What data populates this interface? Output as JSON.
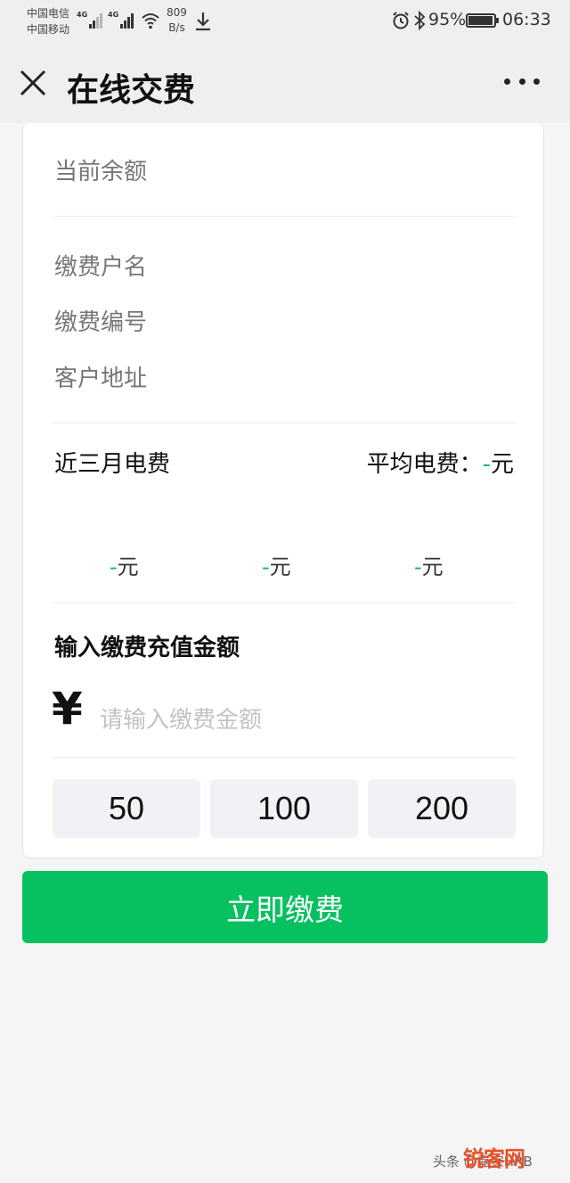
{
  "status_bar": {
    "carrier_1": "中国电信",
    "carrier_2": "中国移动",
    "network_1": "4G",
    "network_2": "4G",
    "speed_value": "809",
    "speed_unit": "B/s",
    "battery": "95%",
    "battery_level": 0.95,
    "time": "06:33",
    "icons": [
      "signal-icon",
      "wifi-icon",
      "download-icon",
      "alarm-icon",
      "bluetooth-icon",
      "battery-icon"
    ]
  },
  "nav": {
    "title": "在线交费",
    "close_icon": "close-icon",
    "more_icon": "more-icon"
  },
  "account": {
    "balance_label": "当前余额",
    "name_label": "缴费户名",
    "number_label": "缴费编号",
    "address_label": "客户地址"
  },
  "bills": {
    "label": "近三月电费",
    "average_prefix": "平均电费：",
    "average_value": "-",
    "unit": "元",
    "months": [
      {
        "value": "-",
        "unit": "元"
      },
      {
        "value": "-",
        "unit": "元"
      },
      {
        "value": "-",
        "unit": "元"
      }
    ]
  },
  "recharge": {
    "title": "输入缴费充值金额",
    "currency_symbol": "¥",
    "placeholder": "请输入缴费金额",
    "presets": [
      "50",
      "100",
      "200"
    ]
  },
  "pay_button": "立即缴费",
  "watermark": {
    "text": "头条 @嘉家HRB",
    "logo": "锐客网"
  },
  "colors": {
    "accent": "#07c160",
    "background": "#f5f5f5",
    "preset_bg": "#f1f2f5"
  }
}
